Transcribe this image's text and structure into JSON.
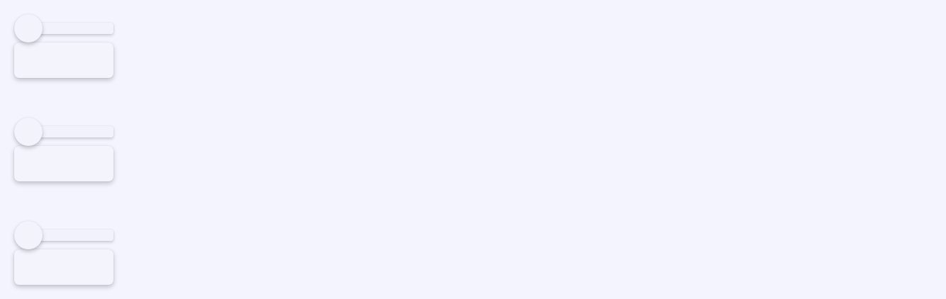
{
  "theme": {
    "background": "#f3f4fd",
    "skeleton_fill": "#f2f3fb"
  },
  "skeleton_cards": [
    {
      "state": "loading"
    },
    {
      "state": "loading"
    },
    {
      "state": "loading"
    }
  ]
}
